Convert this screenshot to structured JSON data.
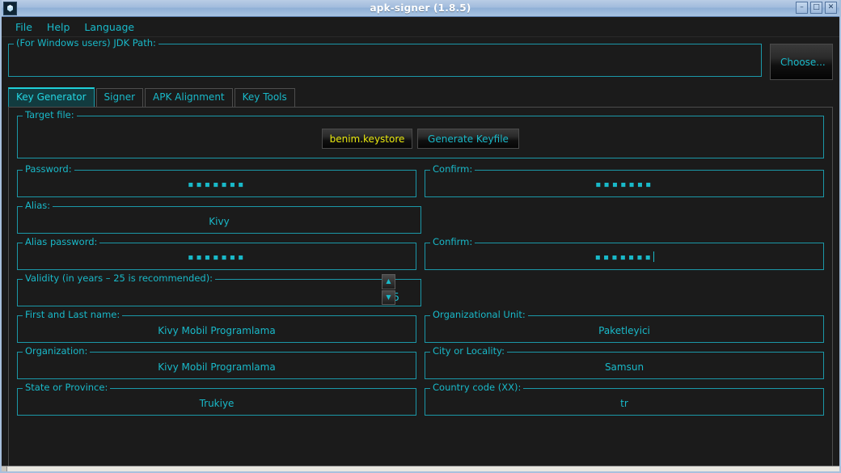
{
  "window": {
    "title": "apk-signer (1.8.5)",
    "icon": "app-icon",
    "controls": {
      "minimize": "–",
      "maximize": "□",
      "close": "✕"
    }
  },
  "menubar": {
    "items": [
      {
        "label": "File"
      },
      {
        "label": "Help"
      },
      {
        "label": "Language"
      }
    ]
  },
  "jdk": {
    "legend": "(For Windows users) JDK Path:",
    "value": "",
    "placeholder": "",
    "choose_label": "Choose..."
  },
  "tabs": [
    {
      "label": "Key Generator",
      "active": true
    },
    {
      "label": "Signer",
      "active": false
    },
    {
      "label": "APK Alignment",
      "active": false
    },
    {
      "label": "Key Tools",
      "active": false
    }
  ],
  "key_generator": {
    "target_file": {
      "legend": "Target file:",
      "keystore_button": "benim.keystore",
      "generate_button": "Generate Keyfile"
    },
    "password": {
      "legend": "Password:",
      "value": "▪▪▪▪▪▪▪",
      "masked_length": 7
    },
    "password_confirm": {
      "legend": "Confirm:",
      "value": "▪▪▪▪▪▪▪",
      "masked_length": 7
    },
    "alias": {
      "legend": "Alias:",
      "value": "Kivy"
    },
    "alias_password": {
      "legend": "Alias password:",
      "value": "▪▪▪▪▪▪▪",
      "masked_length": 7
    },
    "alias_password_confirm": {
      "legend": "Confirm:",
      "value": "▪▪▪▪▪▪▪",
      "masked_length": 7,
      "focused": true
    },
    "validity": {
      "legend": "Validity (in years – 25 is recommended):",
      "value": "25",
      "spinner_up": "▲",
      "spinner_down": "▼"
    },
    "first_last_name": {
      "legend": "First and Last name:",
      "value": "Kivy Mobil Programlama"
    },
    "organizational_unit": {
      "legend": "Organizational Unit:",
      "value": "Paketleyici"
    },
    "organization": {
      "legend": "Organization:",
      "value": "Kivy Mobil Programlama"
    },
    "city_or_locality": {
      "legend": "City or Locality:",
      "value": "Samsun"
    },
    "state_or_province": {
      "legend": "State or Province:",
      "value": "Trukiye"
    },
    "country_code": {
      "legend": "Country code (XX):",
      "value": "tr"
    }
  },
  "colors": {
    "accent_cyan": "#19b9c9",
    "keystore_yellow": "#e8e80e",
    "background": "#1b1b1b",
    "titlebar_blue": "#a2bcdd",
    "active_tab_bg": "#123b3f"
  }
}
